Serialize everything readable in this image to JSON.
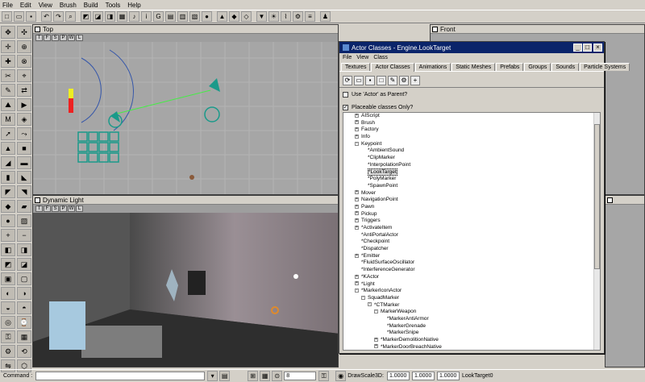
{
  "menu": [
    "File",
    "Edit",
    "View",
    "Brush",
    "Build",
    "Tools",
    "Help"
  ],
  "viewports": {
    "top": "Top",
    "front": "Front",
    "dynamic": "Dynamic Light"
  },
  "dialog": {
    "title": "Actor Classes - Engine.LookTarget",
    "menu": [
      "File",
      "View",
      "Class"
    ],
    "tabs": [
      "Textures",
      "Actor Classes",
      "Animations",
      "Static Meshes",
      "Prefabs",
      "Groups",
      "Sounds",
      "Particle Systems"
    ],
    "active_tab": "Actor Classes",
    "use_actor_parent": "Use 'Actor' as Parent?",
    "placeable_only": "Placeable classes Only?",
    "tree": [
      {
        "label": "AIScript",
        "level": 1,
        "exp": "+"
      },
      {
        "label": "Brush",
        "level": 1,
        "exp": "+"
      },
      {
        "label": "Factory",
        "level": 1,
        "exp": "+"
      },
      {
        "label": "Info",
        "level": 1,
        "exp": "+"
      },
      {
        "label": "Keypoint",
        "level": 1,
        "exp": "-"
      },
      {
        "label": "*AmbientSound",
        "level": 2,
        "exp": ""
      },
      {
        "label": "*ClipMarker",
        "level": 2,
        "exp": ""
      },
      {
        "label": "*InterpolationPoint",
        "level": 2,
        "exp": ""
      },
      {
        "label": "*LookTarget",
        "level": 2,
        "exp": "",
        "selected": true
      },
      {
        "label": "*PolyMarker",
        "level": 2,
        "exp": ""
      },
      {
        "label": "*SpawnPoint",
        "level": 2,
        "exp": ""
      },
      {
        "label": "Mover",
        "level": 1,
        "exp": "+"
      },
      {
        "label": "NavigationPoint",
        "level": 1,
        "exp": "+"
      },
      {
        "label": "Pawn",
        "level": 1,
        "exp": "+"
      },
      {
        "label": "Pickup",
        "level": 1,
        "exp": "+"
      },
      {
        "label": "Triggers",
        "level": 1,
        "exp": "+"
      },
      {
        "label": "*ActivateItem",
        "level": 1,
        "exp": "+"
      },
      {
        "label": "*AntiPortalActor",
        "level": 1,
        "exp": ""
      },
      {
        "label": "*Checkpoint",
        "level": 1,
        "exp": ""
      },
      {
        "label": "*Dispatcher",
        "level": 1,
        "exp": ""
      },
      {
        "label": "*Emitter",
        "level": 1,
        "exp": "+"
      },
      {
        "label": "*FluidSurfaceOscillator",
        "level": 1,
        "exp": ""
      },
      {
        "label": "*InterferenceGenerator",
        "level": 1,
        "exp": ""
      },
      {
        "label": "*KActor",
        "level": 1,
        "exp": "+"
      },
      {
        "label": "*Light",
        "level": 1,
        "exp": "+"
      },
      {
        "label": "*MarkerIconActor",
        "level": 1,
        "exp": "-"
      },
      {
        "label": "SquadMarker",
        "level": 2,
        "exp": "-"
      },
      {
        "label": "*CTMarker",
        "level": 3,
        "exp": "-"
      },
      {
        "label": "MarkerWeapon",
        "level": 4,
        "exp": "-"
      },
      {
        "label": "*MarkerAntiArmor",
        "level": 5,
        "exp": ""
      },
      {
        "label": "*MarkerGrenade",
        "level": 5,
        "exp": ""
      },
      {
        "label": "*MarkerSnipe",
        "level": 5,
        "exp": ""
      },
      {
        "label": "*MarkerDemolitionNative",
        "level": 4,
        "exp": "+"
      },
      {
        "label": "*MarkerDoorBreachNative",
        "level": 4,
        "exp": "+"
      }
    ]
  },
  "status": {
    "command_label": "Command :",
    "grid_value": "8",
    "drawscale_label": "DrawScale3D:",
    "x": "1.0000",
    "y": "1.0000",
    "z": "1.0000",
    "selected": "LookTarget0"
  }
}
